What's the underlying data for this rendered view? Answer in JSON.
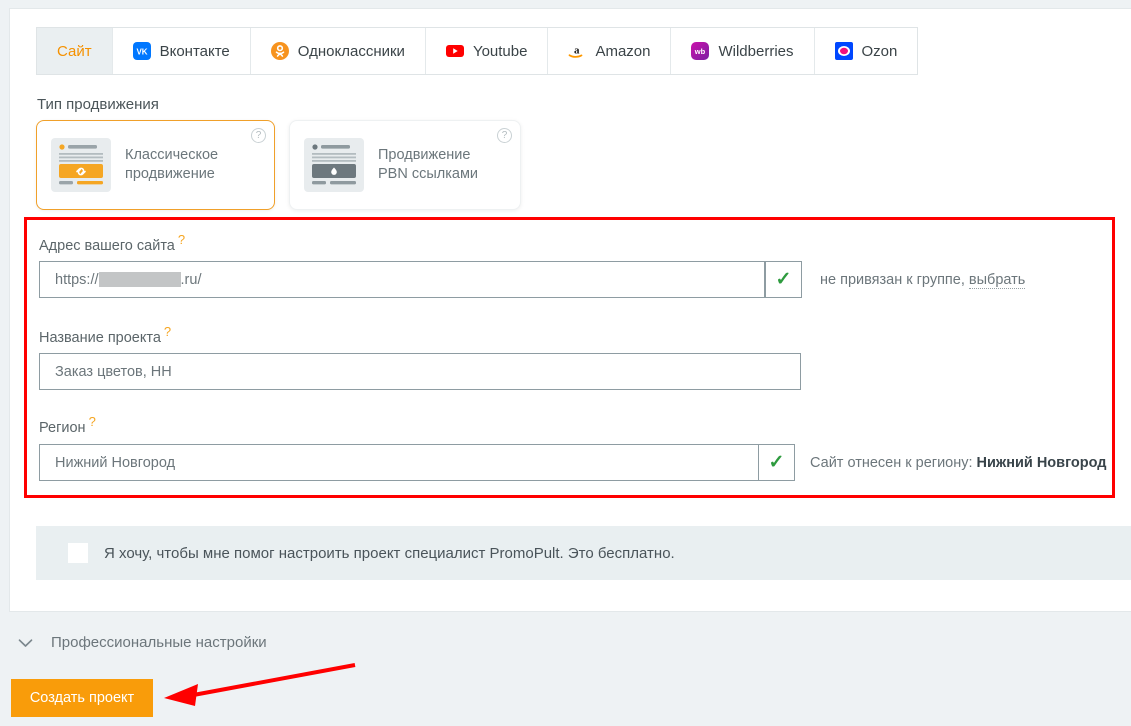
{
  "tabs": [
    {
      "label": "Сайт",
      "icon": "none",
      "active": true
    },
    {
      "label": "Вконтакте",
      "icon": "vk-icon",
      "active": false
    },
    {
      "label": "Одноклассники",
      "icon": "odnoklassniki-icon",
      "active": false
    },
    {
      "label": "Youtube",
      "icon": "youtube-icon",
      "active": false
    },
    {
      "label": "Amazon",
      "icon": "amazon-icon",
      "active": false
    },
    {
      "label": "Wildberries",
      "icon": "wildberries-icon",
      "active": false
    },
    {
      "label": "Ozon",
      "icon": "ozon-icon",
      "active": false
    }
  ],
  "promotion_type": {
    "label": "Тип продвижения",
    "options": [
      {
        "title_line1": "Классическое",
        "title_line2": "продвижение",
        "selected": true,
        "help": "?"
      },
      {
        "title_line1": "Продвижение",
        "title_line2": "PBN ссылками",
        "selected": false,
        "help": "?"
      }
    ]
  },
  "form": {
    "site_address": {
      "label": "Адрес вашего сайта",
      "required_marker": "?",
      "value_prefix": "https://",
      "value_suffix": ".ru/",
      "valid_icon": "check-icon",
      "note_text": "не привязан к группе, ",
      "note_link": "выбрать"
    },
    "project_name": {
      "label": "Название проекта",
      "required_marker": "?",
      "value": "Заказ цветов, НН"
    },
    "region": {
      "label": "Регион",
      "required_marker": "?",
      "value": "Нижний Новгород",
      "valid_icon": "check-icon",
      "note_prefix": "Сайт отнесен к региону: ",
      "note_value": "Нижний Новгород"
    }
  },
  "helper": {
    "checkbox_checked": false,
    "text": "Я хочу, чтобы мне помог настроить проект специалист PromoPult. Это бесплатно."
  },
  "pro_settings": {
    "chevron": "chevron-down-icon",
    "label": "Профессиональные настройки"
  },
  "create_button": {
    "label": "Создать проект"
  },
  "colors": {
    "accent_orange": "#f99c0a",
    "tab_active_text": "#f59100",
    "annotation_red": "#ff0000",
    "check_green": "#2e9b3f",
    "strip_bg": "#e9eff1"
  }
}
